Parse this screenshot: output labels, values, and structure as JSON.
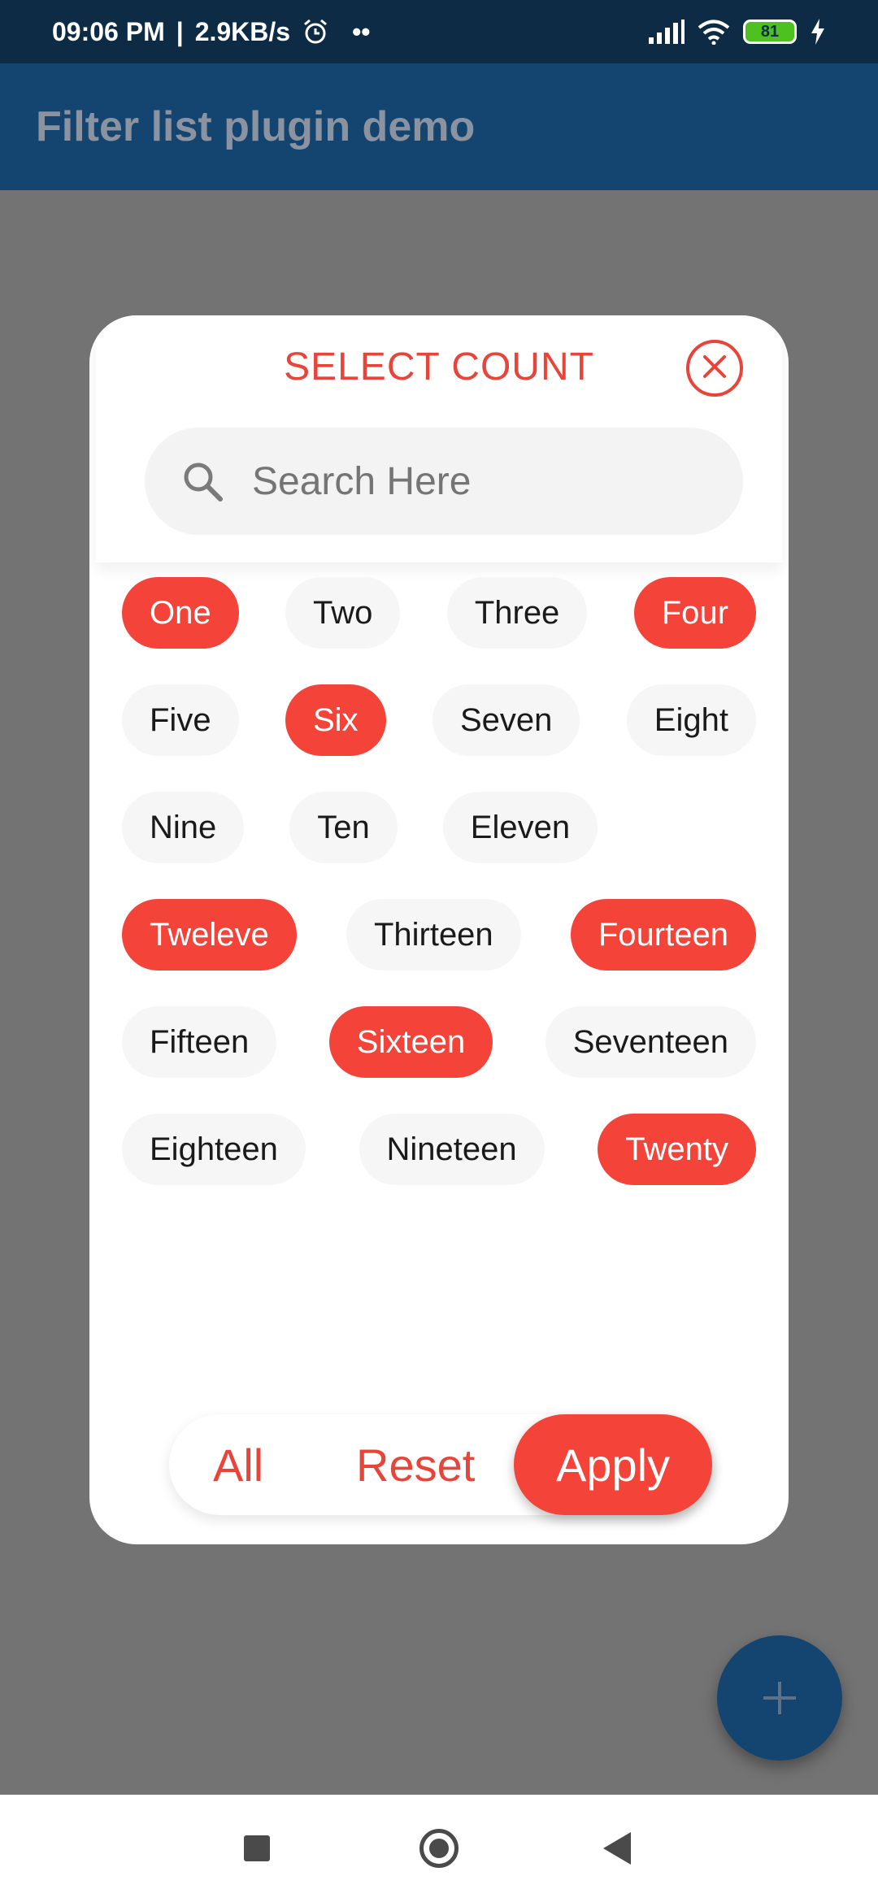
{
  "status_bar": {
    "time": "09:06 PM",
    "separator": "|",
    "net_speed": "2.9KB/s",
    "dots": "••",
    "battery": "81"
  },
  "app_bar": {
    "title": "Filter list plugin demo"
  },
  "dialog": {
    "title": "SELECT COUNT",
    "search_placeholder": "Search Here",
    "rows": [
      [
        {
          "label": "One",
          "selected": true
        },
        {
          "label": "Two",
          "selected": false
        },
        {
          "label": "Three",
          "selected": false
        },
        {
          "label": "Four",
          "selected": true
        }
      ],
      [
        {
          "label": "Five",
          "selected": false
        },
        {
          "label": "Six",
          "selected": true
        },
        {
          "label": "Seven",
          "selected": false
        },
        {
          "label": "Eight",
          "selected": false
        }
      ],
      [
        {
          "label": "Nine",
          "selected": false
        },
        {
          "label": "Ten",
          "selected": false
        },
        {
          "label": "Eleven",
          "selected": false
        }
      ],
      [
        {
          "label": "Tweleve",
          "selected": true
        },
        {
          "label": "Thirteen",
          "selected": false
        },
        {
          "label": "Fourteen",
          "selected": true
        }
      ],
      [
        {
          "label": "Fifteen",
          "selected": false
        },
        {
          "label": "Sixteen",
          "selected": true
        },
        {
          "label": "Seventeen",
          "selected": false
        }
      ],
      [
        {
          "label": "Eighteen",
          "selected": false
        },
        {
          "label": "Nineteen",
          "selected": false
        },
        {
          "label": "Twenty",
          "selected": true
        }
      ]
    ],
    "actions": {
      "all": "All",
      "reset": "Reset",
      "apply": "Apply"
    }
  },
  "fab": {
    "icon": "plus-icon"
  },
  "colors": {
    "accent": "#f4443a",
    "primary": "#134570",
    "status_bar": "#0e2b46",
    "scrim": "#737373"
  }
}
